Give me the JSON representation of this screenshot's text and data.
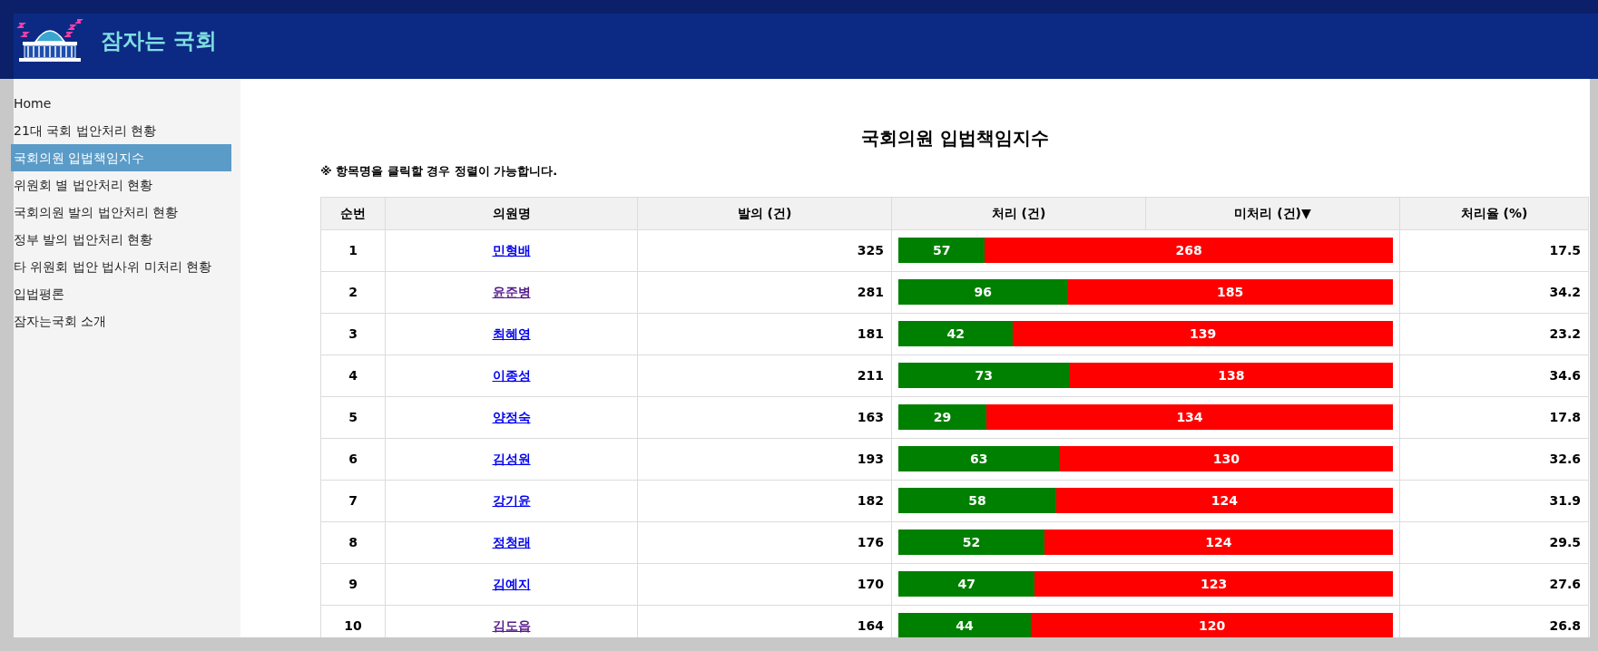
{
  "header": {
    "title": "잠자는 국회"
  },
  "sidebar": {
    "items": [
      {
        "label": "Home",
        "selected": false
      },
      {
        "label": "21대 국회 법안처리 현황",
        "selected": false
      },
      {
        "label": "국회의원 입법책임지수",
        "selected": true
      },
      {
        "label": "위원회 별 법안처리 현황",
        "selected": false
      },
      {
        "label": "국회의원 발의 법안처리 현황",
        "selected": false
      },
      {
        "label": "정부 발의 법안처리 현황",
        "selected": false
      },
      {
        "label": "타 위원회 법안 법사위 미처리 현황",
        "selected": false
      },
      {
        "label": "입법평론",
        "selected": false
      },
      {
        "label": "잠자는국회 소개",
        "selected": false
      }
    ]
  },
  "page": {
    "title": "국회의원 입법책임지수",
    "note": "※ 항목명을 클릭할 경우 정렬이 가능합니다."
  },
  "table": {
    "columns": [
      "순번",
      "의원명",
      "발의 (건)",
      "처리 (건)",
      "미처리 (건)▼",
      "처리율 (%)"
    ],
    "rows": [
      {
        "rank": "1",
        "name": "민형배",
        "visited": false,
        "proposed": "325",
        "processed": "57",
        "unprocessed": "268",
        "level": 0.175,
        "rate": "17.5"
      },
      {
        "rank": "2",
        "name": "윤준병",
        "visited": true,
        "proposed": "281",
        "processed": "96",
        "unprocessed": "185",
        "level": 0.342,
        "rate": "34.2"
      },
      {
        "rank": "3",
        "name": "최혜영",
        "visited": false,
        "proposed": "181",
        "processed": "42",
        "unprocessed": "139",
        "level": 0.232,
        "rate": "23.2"
      },
      {
        "rank": "4",
        "name": "이종성",
        "visited": false,
        "proposed": "211",
        "processed": "73",
        "unprocessed": "138",
        "level": 0.346,
        "rate": "34.6"
      },
      {
        "rank": "5",
        "name": "양정숙",
        "visited": false,
        "proposed": "163",
        "processed": "29",
        "unprocessed": "134",
        "level": 0.178,
        "rate": "17.8"
      },
      {
        "rank": "6",
        "name": "김성원",
        "visited": false,
        "proposed": "193",
        "processed": "63",
        "unprocessed": "130",
        "level": 0.326,
        "rate": "32.6"
      },
      {
        "rank": "7",
        "name": "강기윤",
        "visited": false,
        "proposed": "182",
        "processed": "58",
        "unprocessed": "124",
        "level": 0.319,
        "rate": "31.9"
      },
      {
        "rank": "8",
        "name": "정청래",
        "visited": false,
        "proposed": "176",
        "processed": "52",
        "unprocessed": "124",
        "level": 0.295,
        "rate": "29.5"
      },
      {
        "rank": "9",
        "name": "김예지",
        "visited": false,
        "proposed": "170",
        "processed": "47",
        "unprocessed": "123",
        "level": 0.276,
        "rate": "27.6"
      },
      {
        "rank": "10",
        "name": "김도읍",
        "visited": true,
        "proposed": "164",
        "processed": "44",
        "unprocessed": "120",
        "level": 0.268,
        "rate": "26.8"
      }
    ]
  }
}
